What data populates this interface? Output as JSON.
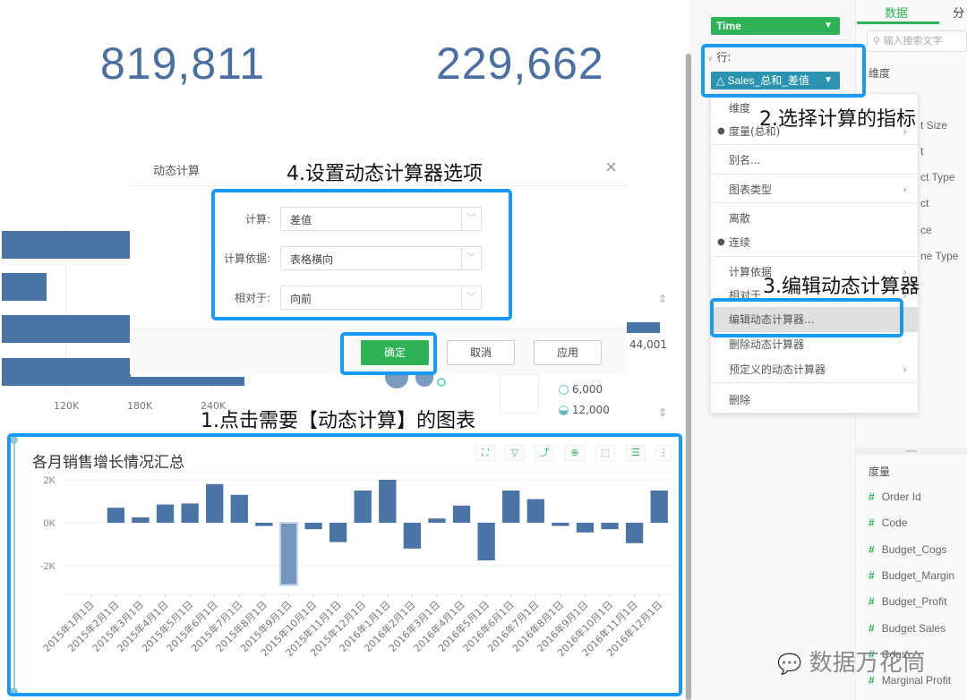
{
  "kpis": [
    {
      "value": "819,811"
    },
    {
      "value": "229,662"
    }
  ],
  "background_chart": {
    "x_ticks": [
      "120K",
      "180K",
      "240K"
    ],
    "legend_values": [
      "44,001",
      "6,000",
      "12,000"
    ]
  },
  "annotations": {
    "step1": "1.点击需要【动态计算】的图表",
    "step2": "2.选择计算的指标",
    "step3": "3.编辑动态计算器",
    "step4": "4.设置动态计算器选项"
  },
  "dialog": {
    "title": "动态计算",
    "close_icon": "×",
    "fields": [
      {
        "label": "计算:",
        "value": "差值"
      },
      {
        "label": "计算依据:",
        "value": "表格横向"
      },
      {
        "label": "相对于:",
        "value": "向前"
      }
    ],
    "buttons": {
      "ok": "确定",
      "cancel": "取消",
      "apply": "应用"
    }
  },
  "shelf": {
    "column_pill": "Time",
    "row_label": "行:",
    "row_pill": "Sales_总和_差值"
  },
  "context_menu": {
    "items": [
      {
        "label": "维度",
        "bullet": false,
        "submenu": false
      },
      {
        "label": "度量(总和)",
        "bullet": true,
        "submenu": true
      },
      {
        "label": "别名...",
        "bullet": false,
        "submenu": false
      },
      {
        "label": "图表类型",
        "bullet": false,
        "submenu": true
      },
      {
        "label": "离散",
        "bullet": false,
        "submenu": false
      },
      {
        "label": "连续",
        "bullet": true,
        "submenu": false
      },
      {
        "label": "计算依据",
        "bullet": false,
        "submenu": true
      },
      {
        "label": "相对于",
        "bullet": false,
        "submenu": true
      },
      {
        "label": "编辑动态计算器...",
        "bullet": false,
        "submenu": false
      },
      {
        "label": "删除动态计算器",
        "bullet": false,
        "submenu": false
      },
      {
        "label": "预定义的动态计算器",
        "bullet": false,
        "submenu": true
      },
      {
        "label": "删除",
        "bullet": false,
        "submenu": false
      }
    ]
  },
  "data_panel": {
    "tabs": [
      "数据",
      "分"
    ],
    "search_placeholder": "输入搜索文字",
    "dimension_header": "维度",
    "dimension_fragments": [
      "t Size",
      "t",
      "ct Type",
      "ct",
      "ce",
      "ne Type"
    ],
    "measure_header": "度量",
    "measures": [
      "Order Id",
      "Code",
      "Budget_Cogs",
      "Budget_Margin",
      "Budget_Profit",
      "Budget Sales",
      "Cogs",
      "Marginal Profit"
    ]
  },
  "watermark": "数据万花筒",
  "chart_card": {
    "toolbar_icons": [
      "fullscreen-icon",
      "filter-icon",
      "drill-icon",
      "zoom-icon",
      "select-icon",
      "list-icon",
      "more-icon"
    ]
  },
  "chart_data": {
    "type": "bar",
    "title": "各月销售增长情况汇总",
    "xlabel": "",
    "ylabel": "",
    "ylim": [
      -3000,
      2200
    ],
    "y_ticks": [
      {
        "value": 2000,
        "label": "2K"
      },
      {
        "value": 0,
        "label": "0K"
      },
      {
        "value": -2000,
        "label": "-2K"
      }
    ],
    "grid": true,
    "categories": [
      "2015年1月1日",
      "2015年2月1日",
      "2015年3月1日",
      "2015年4月1日",
      "2015年5月1日",
      "2015年6月1日",
      "2015年7月1日",
      "2015年8月1日",
      "2015年9月1日",
      "2015年10月1日",
      "2015年11月1日",
      "2015年12月1日",
      "2016年1月1日",
      "2016年2月1日",
      "2016年3月1日",
      "2016年4月1日",
      "2016年5月1日",
      "2016年6月1日",
      "2016年7月1日",
      "2016年8月1日",
      "2016年9月1日",
      "2016年10月1日",
      "2016年11月1日",
      "2016年12月1日"
    ],
    "values": [
      0,
      700,
      250,
      850,
      900,
      1800,
      1300,
      -150,
      -2900,
      -300,
      -900,
      1500,
      2000,
      -1200,
      200,
      800,
      -1750,
      1500,
      1100,
      -150,
      -450,
      -300,
      -950,
      1500
    ],
    "highlighted_index": 8,
    "bar_color": "#4a74a5"
  }
}
